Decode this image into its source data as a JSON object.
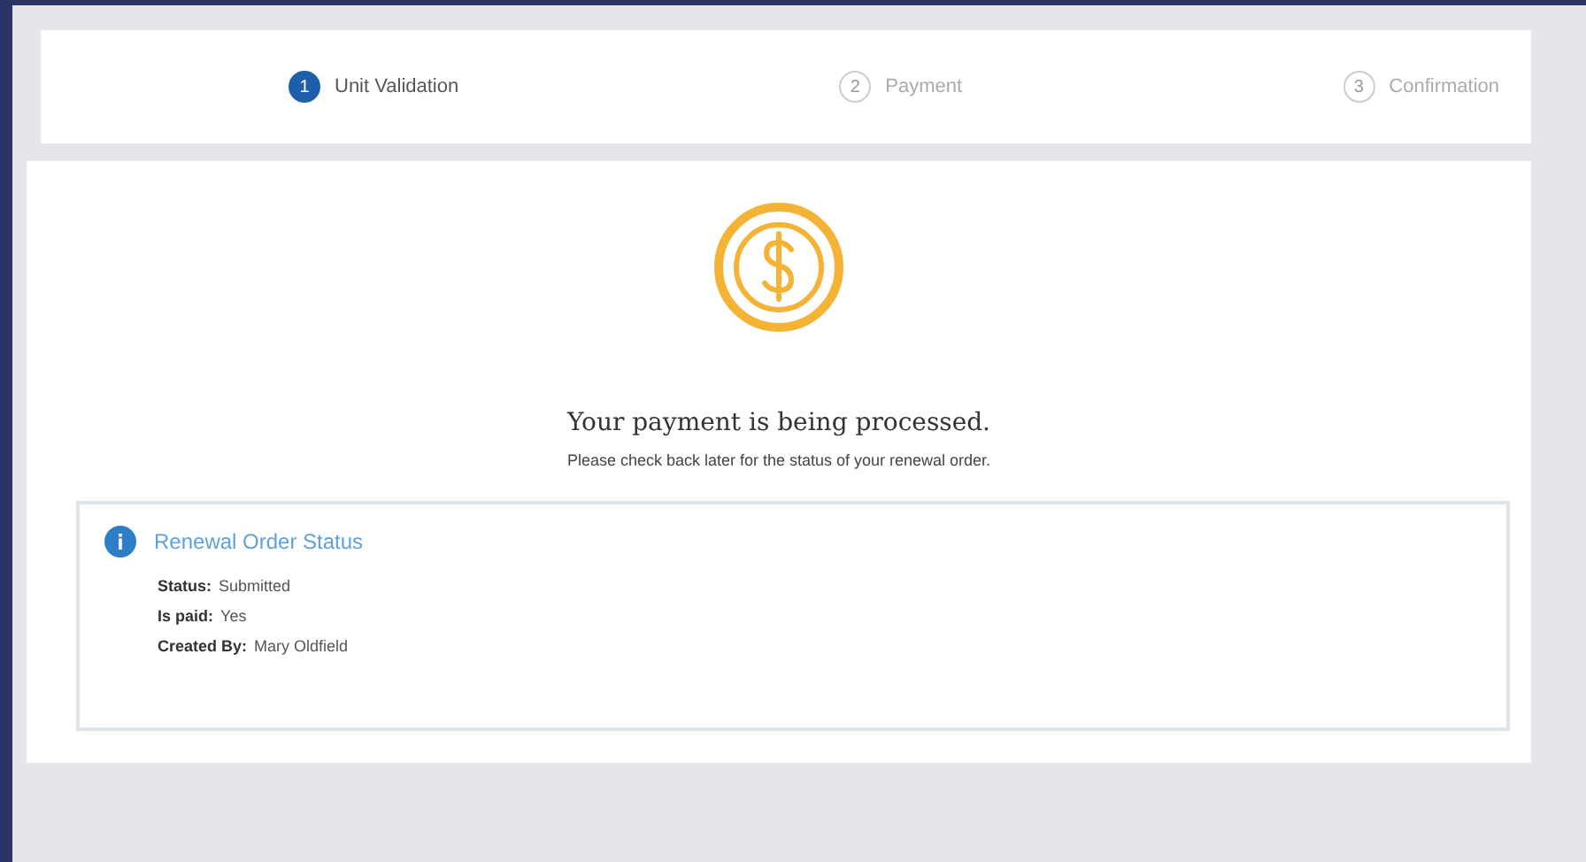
{
  "steps": [
    {
      "number": "1",
      "label": "Unit Validation",
      "selected": true
    },
    {
      "number": "2",
      "label": "Payment",
      "selected": false
    },
    {
      "number": "3",
      "label": "Confirmation",
      "selected": false
    }
  ],
  "message": {
    "title": "Your payment is being processed.",
    "subtitle": "Please check back later for the status of your renewal order."
  },
  "status_panel": {
    "title": "Renewal Order Status",
    "fields": [
      {
        "label": "Status:",
        "value": "Submitted"
      },
      {
        "label": "Is paid:",
        "value": "Yes"
      },
      {
        "label": "Created By:",
        "value": "Mary Oldfield"
      }
    ]
  }
}
